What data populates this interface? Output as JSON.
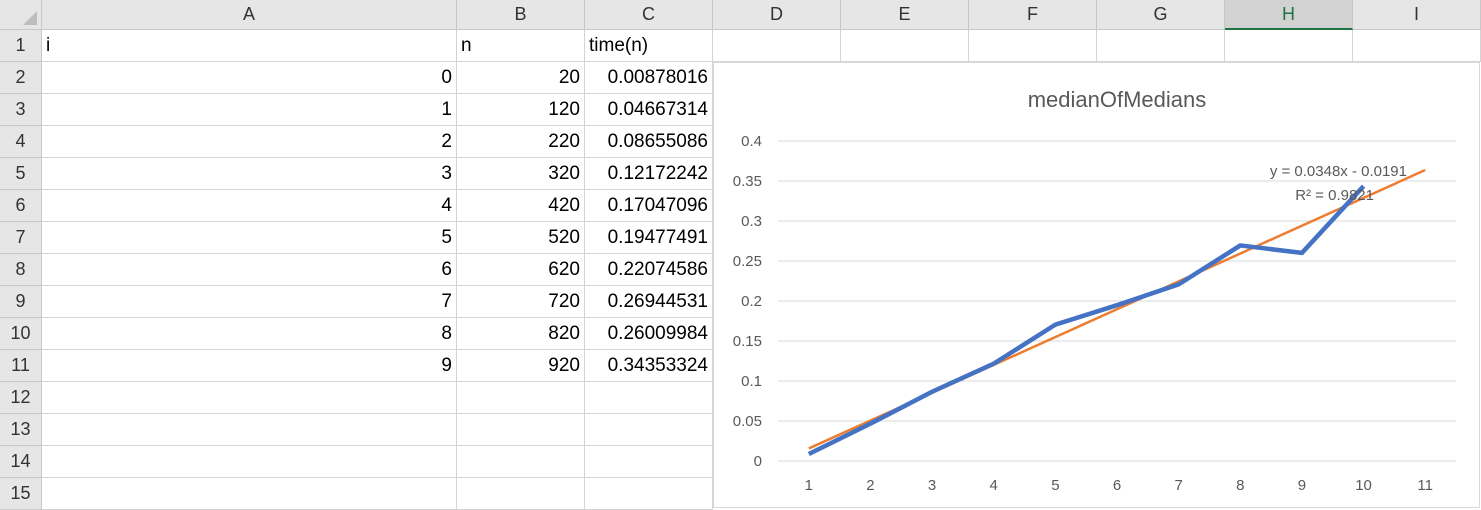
{
  "columns": [
    "A",
    "B",
    "C",
    "D",
    "E",
    "F",
    "G",
    "H",
    "I"
  ],
  "selected_column": "H",
  "rows": [
    "1",
    "2",
    "3",
    "4",
    "5",
    "6",
    "7",
    "8",
    "9",
    "10",
    "11",
    "12",
    "13",
    "14",
    "15"
  ],
  "headers": {
    "A": "i",
    "B": "n",
    "C": "time(n)"
  },
  "table": [
    {
      "i": "0",
      "n": "20",
      "t": "0.00878016"
    },
    {
      "i": "1",
      "n": "120",
      "t": "0.04667314"
    },
    {
      "i": "2",
      "n": "220",
      "t": "0.08655086"
    },
    {
      "i": "3",
      "n": "320",
      "t": "0.12172242"
    },
    {
      "i": "4",
      "n": "420",
      "t": "0.17047096"
    },
    {
      "i": "5",
      "n": "520",
      "t": "0.19477491"
    },
    {
      "i": "6",
      "n": "620",
      "t": "0.22074586"
    },
    {
      "i": "7",
      "n": "720",
      "t": "0.26944531"
    },
    {
      "i": "8",
      "n": "820",
      "t": "0.26009984"
    },
    {
      "i": "9",
      "n": "920",
      "t": "0.34353324"
    }
  ],
  "chart_data": {
    "type": "line",
    "title": "medianOfMedians",
    "xlabel": "",
    "ylabel": "",
    "categories": [
      "1",
      "2",
      "3",
      "4",
      "5",
      "6",
      "7",
      "8",
      "9",
      "10",
      "11"
    ],
    "ylim": [
      0,
      0.4
    ],
    "yticks": [
      "0",
      "0.05",
      "0.1",
      "0.15",
      "0.2",
      "0.25",
      "0.3",
      "0.35",
      "0.4"
    ],
    "grid": true,
    "legend": "none",
    "series": [
      {
        "color": "#4472c4",
        "values": [
          0.00878016,
          0.04667314,
          0.08655086,
          0.12172242,
          0.17047096,
          0.19477491,
          0.22074586,
          0.26944531,
          0.26009984,
          0.34353324
        ]
      }
    ],
    "trendline": {
      "color": "#ed7d31",
      "slope": 0.0348,
      "intercept": -0.0191,
      "x_range": [
        1,
        11
      ]
    },
    "annotations": [
      "y = 0.0348x - 0.0191",
      "R² = 0.9821"
    ]
  }
}
